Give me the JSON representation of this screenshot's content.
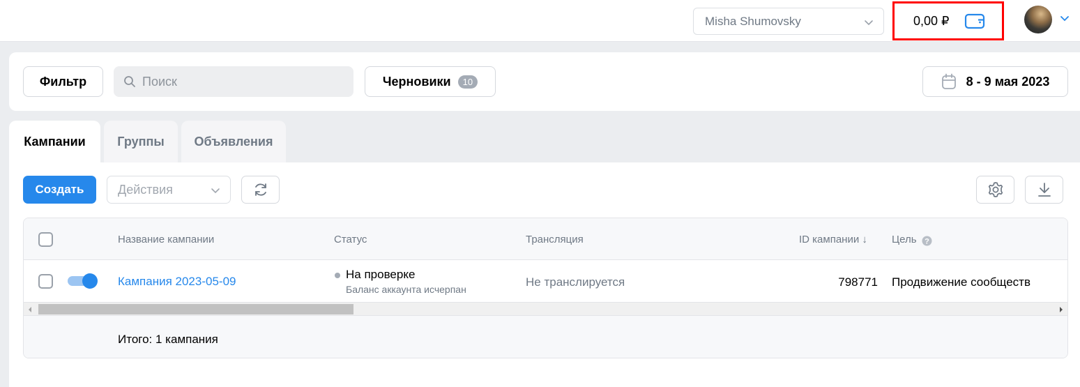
{
  "header": {
    "account_name": "Misha Shumovsky",
    "balance": "0,00 ₽",
    "icons": {
      "wallet": "wallet-icon",
      "avatar": "user-avatar",
      "chevron": "chevron-down-icon"
    }
  },
  "toolbar": {
    "filter_label": "Фильтр",
    "search_placeholder": "Поиск",
    "drafts_label": "Черновики",
    "drafts_count": "10",
    "date_range": "8 - 9 мая 2023"
  },
  "tabs": [
    {
      "label": "Кампании",
      "active": true
    },
    {
      "label": "Группы",
      "active": false
    },
    {
      "label": "Объявления",
      "active": false
    }
  ],
  "actions": {
    "create_label": "Создать",
    "actions_placeholder": "Действия"
  },
  "table": {
    "columns": [
      "Название кампании",
      "Статус",
      "Трансляция",
      "ID кампании ↓",
      "Цель"
    ],
    "rows": [
      {
        "name": "Кампания 2023-05-09",
        "status": "На проверке",
        "status_note": "Баланс аккаунта исчерпан",
        "broadcast": "Не транслируется",
        "id": "798771",
        "goal": "Продвижение сообществ",
        "enabled": true
      }
    ],
    "total": "Итого: 1 кампания"
  },
  "colors": {
    "accent": "#2688eb",
    "highlight_border": "#ff0000",
    "background": "#ebedf0",
    "muted_text": "#6f7985"
  }
}
